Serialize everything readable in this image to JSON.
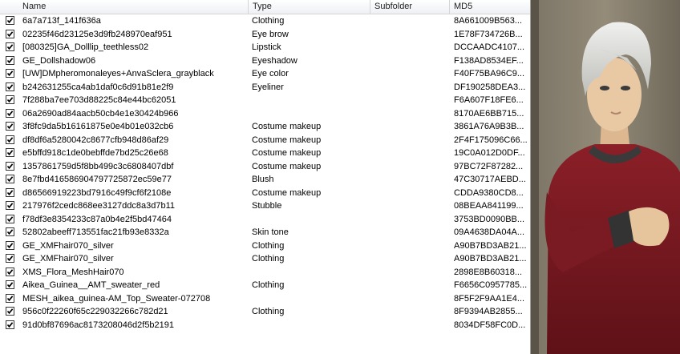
{
  "columns": {
    "name": "Name",
    "type": "Type",
    "subfolder": "Subfolder",
    "md5": "MD5"
  },
  "rows": [
    {
      "name": "6a7a713f_141f636a",
      "type": "Clothing",
      "subfolder": "",
      "md5": "8A661009B563..."
    },
    {
      "name": "02235f46d23125e3d9fb248970eaf951",
      "type": "Eye brow",
      "subfolder": "",
      "md5": "1E78F734726B..."
    },
    {
      "name": "[080325]GA_Dolllip_teethless02",
      "type": "Lipstick",
      "subfolder": "",
      "md5": "DCCAADC4107..."
    },
    {
      "name": "GE_Dollshadow06",
      "type": "Eyeshadow",
      "subfolder": "",
      "md5": "F138AD8534EF..."
    },
    {
      "name": "[UW]DMpheromonaleyes+AnvaSclera_grayblack",
      "type": "Eye color",
      "subfolder": "",
      "md5": "F40F75BA96C9..."
    },
    {
      "name": "b242631255ca4ab1daf0c6d91b81e2f9",
      "type": "Eyeliner",
      "subfolder": "",
      "md5": "DF190258DEA3..."
    },
    {
      "name": "7f288ba7ee703d88225c84e44bc62051",
      "type": "",
      "subfolder": "",
      "md5": "F6A607F18FE6..."
    },
    {
      "name": "06a2690ad84aacb50cb4e1e30424b966",
      "type": "",
      "subfolder": "",
      "md5": "8170AE6BB715..."
    },
    {
      "name": "3f8fc9da5b16161875e0e4b01e032cb6",
      "type": "Costume makeup",
      "subfolder": "",
      "md5": "3861A76A9B3B..."
    },
    {
      "name": "df8df6a5280042c8677cfb948d86af29",
      "type": "Costume makeup",
      "subfolder": "",
      "md5": "2F4F175096C66..."
    },
    {
      "name": "e5bffd918c1de0bebffde7bd25c26e68",
      "type": "Costume makeup",
      "subfolder": "",
      "md5": "19C0A012D0DF..."
    },
    {
      "name": "1357861759d5f8bb499c3c6808407dbf",
      "type": "Costume makeup",
      "subfolder": "",
      "md5": "97BC72F87282..."
    },
    {
      "name": "8e7fbd416586904797725872​ec59e77",
      "type": "Blush",
      "subfolder": "",
      "md5": "47C30717AEBD..."
    },
    {
      "name": "d86566919223bd7916c49f9cf6f2108e",
      "type": "Costume makeup",
      "subfolder": "",
      "md5": "CDDA9380CD8..."
    },
    {
      "name": "217976f2cedc868ee3127ddc8a3d7b11",
      "type": "Stubble",
      "subfolder": "",
      "md5": "08BEAA841199..."
    },
    {
      "name": "f78df3e8354233c87a0b4e2f5bd47464",
      "type": "",
      "subfolder": "",
      "md5": "3753BD0090BB..."
    },
    {
      "name": "52802abeeff713551fac21fb93e8332a",
      "type": "Skin tone",
      "subfolder": "",
      "md5": "09A4638DA04A..."
    },
    {
      "name": "GE_XMFhair070_silver",
      "type": "Clothing",
      "subfolder": "",
      "md5": "A90B7BD3AB21..."
    },
    {
      "name": "GE_XMFhair070_silver",
      "type": "Clothing",
      "subfolder": "",
      "md5": "A90B7BD3AB21..."
    },
    {
      "name": "XMS_Flora_MeshHair070",
      "type": "",
      "subfolder": "",
      "md5": "2898E8B60318..."
    },
    {
      "name": "Aikea_Guinea__AMT_sweater_red",
      "type": "Clothing",
      "subfolder": "",
      "md5": "F6656C0957785..."
    },
    {
      "name": "MESH_aikea_guinea-AM_Top_Sweater-072708",
      "type": "",
      "subfolder": "",
      "md5": "8F5F2F9AA1E4..."
    },
    {
      "name": "956c0f22260f65c229032266c782d21",
      "type": "Clothing",
      "subfolder": "",
      "md5": "8F9394AB2855..."
    },
    {
      "name": "91d0bf87696ac8173208046d2f5b2191",
      "type": "",
      "subfolder": "",
      "md5": "8034DF58FC0D..."
    }
  ],
  "colors": {
    "sweater": "#7a1a22",
    "hair": "#d8d8d6",
    "skin": "#e9c9a4",
    "wall": "#8a8170"
  }
}
